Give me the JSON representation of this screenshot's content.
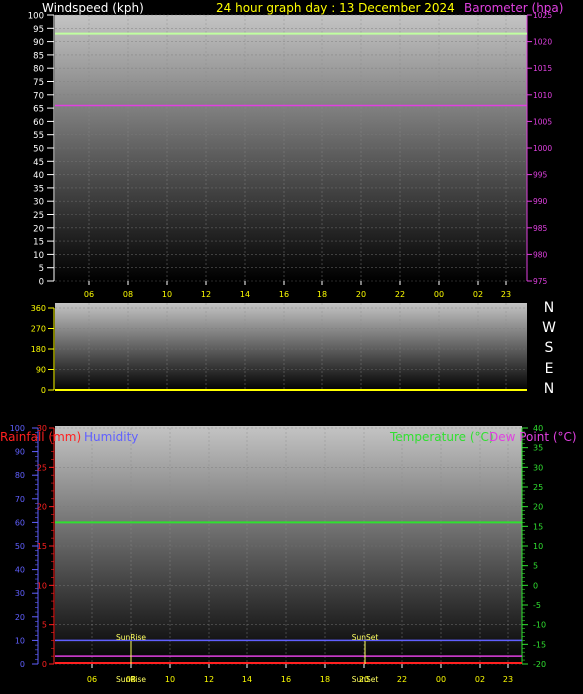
{
  "colors": {
    "background": "#000000",
    "windspeed_title": "#ffffff",
    "graph_title": "#ffff00",
    "barometer": "#e040e0",
    "wind_direction": "#ffffff",
    "rainfall": "#ff2020",
    "humidity": "#6060ff",
    "temperature": "#30e030",
    "dew_point": "#e040e0",
    "time_labels": "#ffff00",
    "sun_events": "#ffff60",
    "windspeed_line": "#c0ffa0",
    "panel_top": "#bfbfbf",
    "panel_bottom": "#000000"
  },
  "chart_data": [
    {
      "type": "line",
      "title": "24 hour graph day : 13 December 2024",
      "ylabel": "Windspeed (kph)",
      "y2label": "Barometer (hpa)",
      "ylim": [
        0,
        100
      ],
      "y2lim": [
        975,
        1025
      ],
      "yticks": [
        "0",
        "5",
        "10",
        "15",
        "20",
        "25",
        "30",
        "35",
        "40",
        "45",
        "50",
        "55",
        "60",
        "65",
        "70",
        "75",
        "80",
        "85",
        "90",
        "95",
        "100"
      ],
      "y2ticks": [
        "975",
        "980",
        "985",
        "990",
        "995",
        "1000",
        "1005",
        "1010",
        "1015",
        "1020",
        "1025"
      ],
      "xticks": [
        "06",
        "08",
        "10",
        "12",
        "14",
        "16",
        "18",
        "20",
        "22",
        "00",
        "02",
        "23"
      ],
      "series": [
        {
          "name": "Windspeed (kph)",
          "axis": "left",
          "y": 93
        },
        {
          "name": "Barometer (hpa)",
          "axis": "right",
          "y": 1008
        }
      ]
    },
    {
      "type": "line",
      "yticks": [
        "0",
        "90",
        "180",
        "270",
        "360"
      ],
      "ylim": [
        0,
        360
      ],
      "direction_labels": [
        "N",
        "W",
        "S",
        "E",
        "N"
      ],
      "series": [
        {
          "name": "Wind direction",
          "y": 0
        }
      ]
    },
    {
      "type": "line",
      "left_outer_label": "Rainfall (mm)",
      "left_inner_label": "Humidity",
      "right_label_a": "Temperature (°C)",
      "right_label_b": "Dew Point (°C)",
      "humidity_ticks": [
        "0",
        "10",
        "20",
        "30",
        "40",
        "50",
        "60",
        "70",
        "80",
        "90",
        "100"
      ],
      "humidity_lim": [
        0,
        100
      ],
      "rain_ticks": [
        "0",
        "5",
        "10",
        "15",
        "20",
        "25",
        "30"
      ],
      "rain_lim": [
        0,
        30
      ],
      "temp_ticks": [
        "-20",
        "-15",
        "-10",
        "-5",
        "0",
        "5",
        "10",
        "15",
        "20",
        "25",
        "30",
        "35",
        "40"
      ],
      "temp_lim": [
        -20,
        40
      ],
      "xticks": [
        "06",
        "08",
        "10",
        "12",
        "14",
        "16",
        "18",
        "20",
        "22",
        "00",
        "02",
        "23"
      ],
      "sunrise_label": "SunRise",
      "sunset_label": "SunSet",
      "sunrise_tick_label": "SunRise",
      "sunset_tick_label": "SunSet",
      "sunrise_x": 8.0,
      "sunset_x": 20.0,
      "series": [
        {
          "name": "Temperature (°C)",
          "axis": "temp",
          "y": 16
        },
        {
          "name": "Humidity",
          "axis": "humidity",
          "y": 10
        },
        {
          "name": "Dew Point (°C)",
          "axis": "temp",
          "y": -18
        },
        {
          "name": "Rainfall (mm)",
          "axis": "rain",
          "y": 0
        }
      ]
    }
  ]
}
